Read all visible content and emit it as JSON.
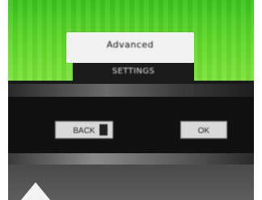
{
  "dialog": {
    "title_text": "Advanced",
    "subtitle_text": "SETTINGS"
  },
  "buttons": {
    "left_label": "BACK",
    "right_label": "OK"
  },
  "icons": {
    "bottom_left": "up-arrow-icon"
  },
  "colors": {
    "background_green": "#62d92a",
    "label_box": "#f1f1f1",
    "subtitle_box": "#1b1b1b",
    "button": "#d9d9d9",
    "arrow": "#f3f3f3"
  }
}
